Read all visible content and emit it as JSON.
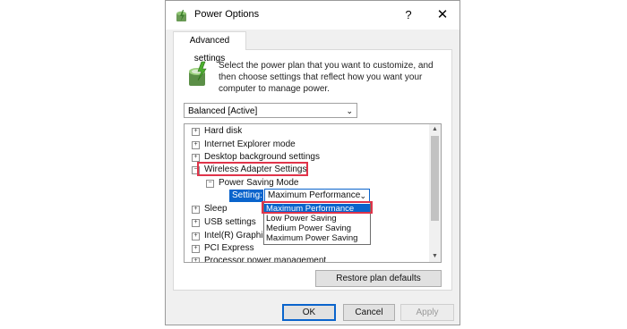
{
  "window": {
    "title": "Power Options",
    "help_label": "?",
    "close_label": "✕"
  },
  "tab": {
    "label": "Advanced settings"
  },
  "intro_text": "Select the power plan that you want to customize, and then choose settings that reflect how you want your computer to manage power.",
  "plan_select": {
    "value": "Balanced [Active]"
  },
  "tree": {
    "items": [
      {
        "label": "Hard disk",
        "expander": "+"
      },
      {
        "label": "Internet Explorer mode",
        "expander": "+"
      },
      {
        "label": "Desktop background settings",
        "expander": "+"
      },
      {
        "label": "Wireless Adapter Settings",
        "expander": "−"
      },
      {
        "label": "Power Saving Mode",
        "expander": "−"
      },
      {
        "label": "Sleep",
        "expander": "+"
      },
      {
        "label": "USB settings",
        "expander": "+"
      },
      {
        "label": "Intel(R) Graphics Settings",
        "expander": "+"
      },
      {
        "label": "PCI Express",
        "expander": "+"
      },
      {
        "label": "Processor power management",
        "expander": "+"
      }
    ],
    "setting_label": "Setting:",
    "setting_value": "Maximum Performance",
    "dropdown_options": [
      "Maximum Performance",
      "Low Power Saving",
      "Medium Power Saving",
      "Maximum Power Saving"
    ],
    "dropdown_selected": "Maximum Performance"
  },
  "buttons": {
    "restore": "Restore plan defaults",
    "ok": "OK",
    "cancel": "Cancel",
    "apply": "Apply"
  },
  "colors": {
    "highlight": "#e0344a",
    "selection": "#0a64cc"
  },
  "icons": [
    "power-options-icon",
    "power-plan-icon",
    "chevron-down-icon",
    "scroll-up-icon",
    "scroll-down-icon"
  ]
}
